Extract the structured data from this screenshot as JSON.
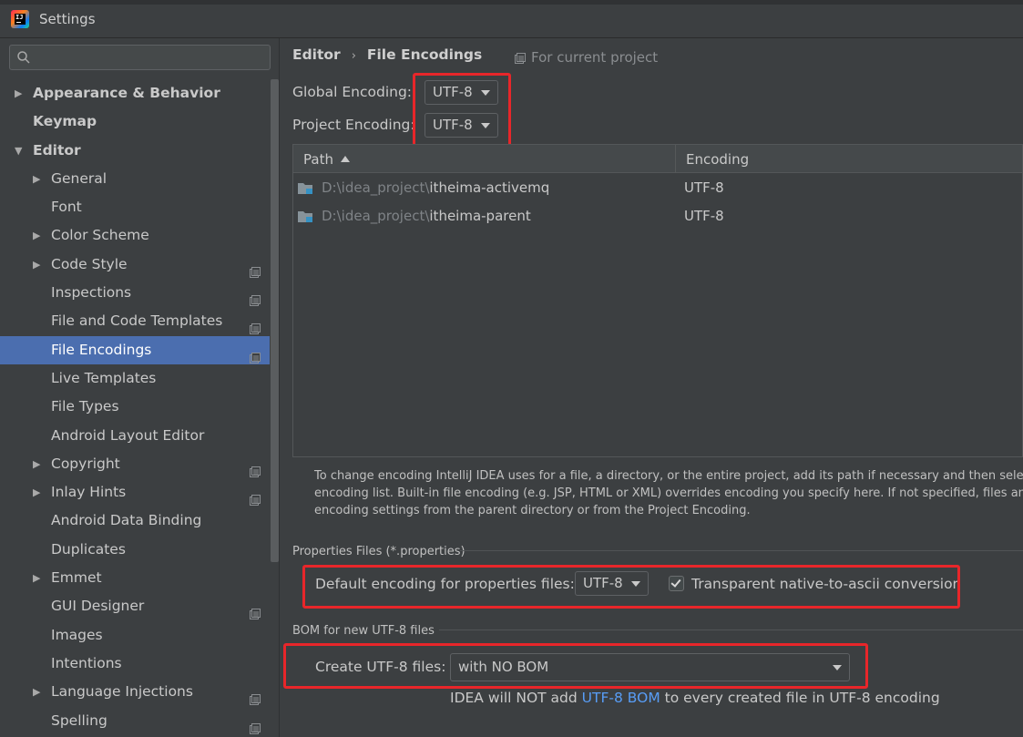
{
  "window": {
    "title": "Settings"
  },
  "sidebar": {
    "search": {
      "placeholder": "",
      "value": ""
    },
    "items": [
      {
        "label": "Appearance & Behavior",
        "level": 0,
        "expander": "collapsed",
        "bold": true,
        "project": false,
        "selected": false
      },
      {
        "label": "Keymap",
        "level": 0,
        "expander": "none",
        "bold": true,
        "project": false,
        "selected": false
      },
      {
        "label": "Editor",
        "level": 0,
        "expander": "expanded",
        "bold": true,
        "project": false,
        "selected": false
      },
      {
        "label": "General",
        "level": 1,
        "expander": "collapsed",
        "bold": false,
        "project": false,
        "selected": false
      },
      {
        "label": "Font",
        "level": 1,
        "expander": "none",
        "bold": false,
        "project": false,
        "selected": false
      },
      {
        "label": "Color Scheme",
        "level": 1,
        "expander": "collapsed",
        "bold": false,
        "project": false,
        "selected": false
      },
      {
        "label": "Code Style",
        "level": 1,
        "expander": "collapsed",
        "bold": false,
        "project": true,
        "selected": false
      },
      {
        "label": "Inspections",
        "level": 1,
        "expander": "none",
        "bold": false,
        "project": true,
        "selected": false
      },
      {
        "label": "File and Code Templates",
        "level": 1,
        "expander": "none",
        "bold": false,
        "project": true,
        "selected": false
      },
      {
        "label": "File Encodings",
        "level": 1,
        "expander": "none",
        "bold": false,
        "project": true,
        "selected": true
      },
      {
        "label": "Live Templates",
        "level": 1,
        "expander": "none",
        "bold": false,
        "project": false,
        "selected": false
      },
      {
        "label": "File Types",
        "level": 1,
        "expander": "none",
        "bold": false,
        "project": false,
        "selected": false
      },
      {
        "label": "Android Layout Editor",
        "level": 1,
        "expander": "none",
        "bold": false,
        "project": false,
        "selected": false
      },
      {
        "label": "Copyright",
        "level": 1,
        "expander": "collapsed",
        "bold": false,
        "project": true,
        "selected": false
      },
      {
        "label": "Inlay Hints",
        "level": 1,
        "expander": "collapsed",
        "bold": false,
        "project": true,
        "selected": false
      },
      {
        "label": "Android Data Binding",
        "level": 1,
        "expander": "none",
        "bold": false,
        "project": false,
        "selected": false
      },
      {
        "label": "Duplicates",
        "level": 1,
        "expander": "none",
        "bold": false,
        "project": false,
        "selected": false
      },
      {
        "label": "Emmet",
        "level": 1,
        "expander": "collapsed",
        "bold": false,
        "project": false,
        "selected": false
      },
      {
        "label": "GUI Designer",
        "level": 1,
        "expander": "none",
        "bold": false,
        "project": true,
        "selected": false
      },
      {
        "label": "Images",
        "level": 1,
        "expander": "none",
        "bold": false,
        "project": false,
        "selected": false
      },
      {
        "label": "Intentions",
        "level": 1,
        "expander": "none",
        "bold": false,
        "project": false,
        "selected": false
      },
      {
        "label": "Language Injections",
        "level": 1,
        "expander": "collapsed",
        "bold": false,
        "project": true,
        "selected": false
      },
      {
        "label": "Spelling",
        "level": 1,
        "expander": "none",
        "bold": false,
        "project": true,
        "selected": false
      }
    ]
  },
  "main": {
    "breadcrumb": [
      "Editor",
      "File Encodings"
    ],
    "scope_label": "For current project",
    "global_encoding": {
      "label": "Global Encoding:",
      "value": "UTF-8"
    },
    "project_encoding": {
      "label": "Project Encoding:",
      "value": "UTF-8"
    },
    "table": {
      "columns": [
        "Path",
        "Encoding"
      ],
      "rows": [
        {
          "path_prefix": "D:\\idea_project\\",
          "path_name": "itheima-activemq",
          "encoding": "UTF-8"
        },
        {
          "path_prefix": "D:\\idea_project\\",
          "path_name": "itheima-parent",
          "encoding": "UTF-8"
        }
      ]
    },
    "help_lines": [
      "To change encoding IntelliJ IDEA uses for a file, a directory, or the entire project, add its path if necessary and then select enco",
      "encoding list. Built-in file encoding (e.g. JSP, HTML or XML) overrides encoding you specify here. If not specified, files and direc",
      "encoding settings from the parent directory or from the Project Encoding."
    ],
    "properties": {
      "section_title": "Properties Files (*.properties)",
      "default_label": "Default encoding for properties files:",
      "default_value": "UTF-8",
      "transparent_label": "Transparent native-to-ascii conversion",
      "transparent_checked": true
    },
    "bom": {
      "section_title": "BOM for new UTF-8 files",
      "create_label": "Create UTF-8 files:",
      "create_value": "with NO BOM",
      "note_before": "IDEA will NOT add ",
      "note_link": "UTF-8 BOM",
      "note_after": " to every created file in UTF-8 encoding"
    }
  },
  "colors": {
    "background": "#3c3f41",
    "selection": "#4b6eaf",
    "highlight_box": "#e8262a",
    "link": "#589df6"
  }
}
